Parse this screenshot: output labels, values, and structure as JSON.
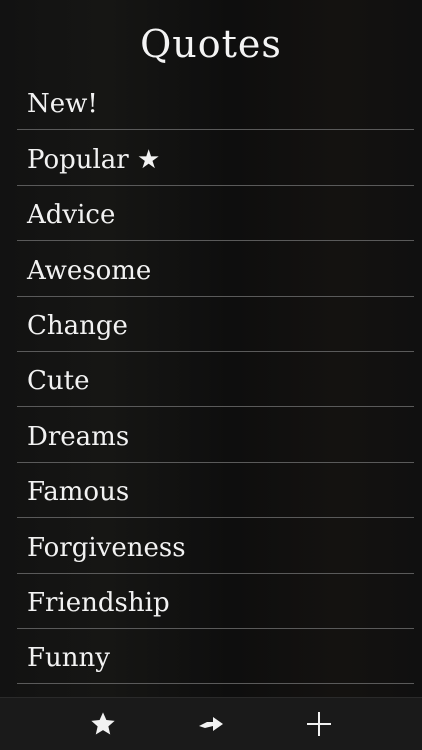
{
  "header": {
    "title": "Quotes"
  },
  "categories": [
    {
      "label": "New!"
    },
    {
      "label": "Popular ★"
    },
    {
      "label": "Advice"
    },
    {
      "label": "Awesome"
    },
    {
      "label": "Change"
    },
    {
      "label": "Cute"
    },
    {
      "label": "Dreams"
    },
    {
      "label": "Famous"
    },
    {
      "label": "Forgiveness"
    },
    {
      "label": "Friendship"
    },
    {
      "label": "Funny"
    }
  ],
  "toolbar": {
    "items": [
      {
        "icon": "star-icon"
      },
      {
        "icon": "forward-arrow-icon"
      },
      {
        "icon": "plus-icon"
      }
    ]
  },
  "colors": {
    "background": "#0b0b0b",
    "text": "#f2f2f2",
    "separator": "#5a5a5a",
    "toolbar": "#1a1a1a"
  }
}
